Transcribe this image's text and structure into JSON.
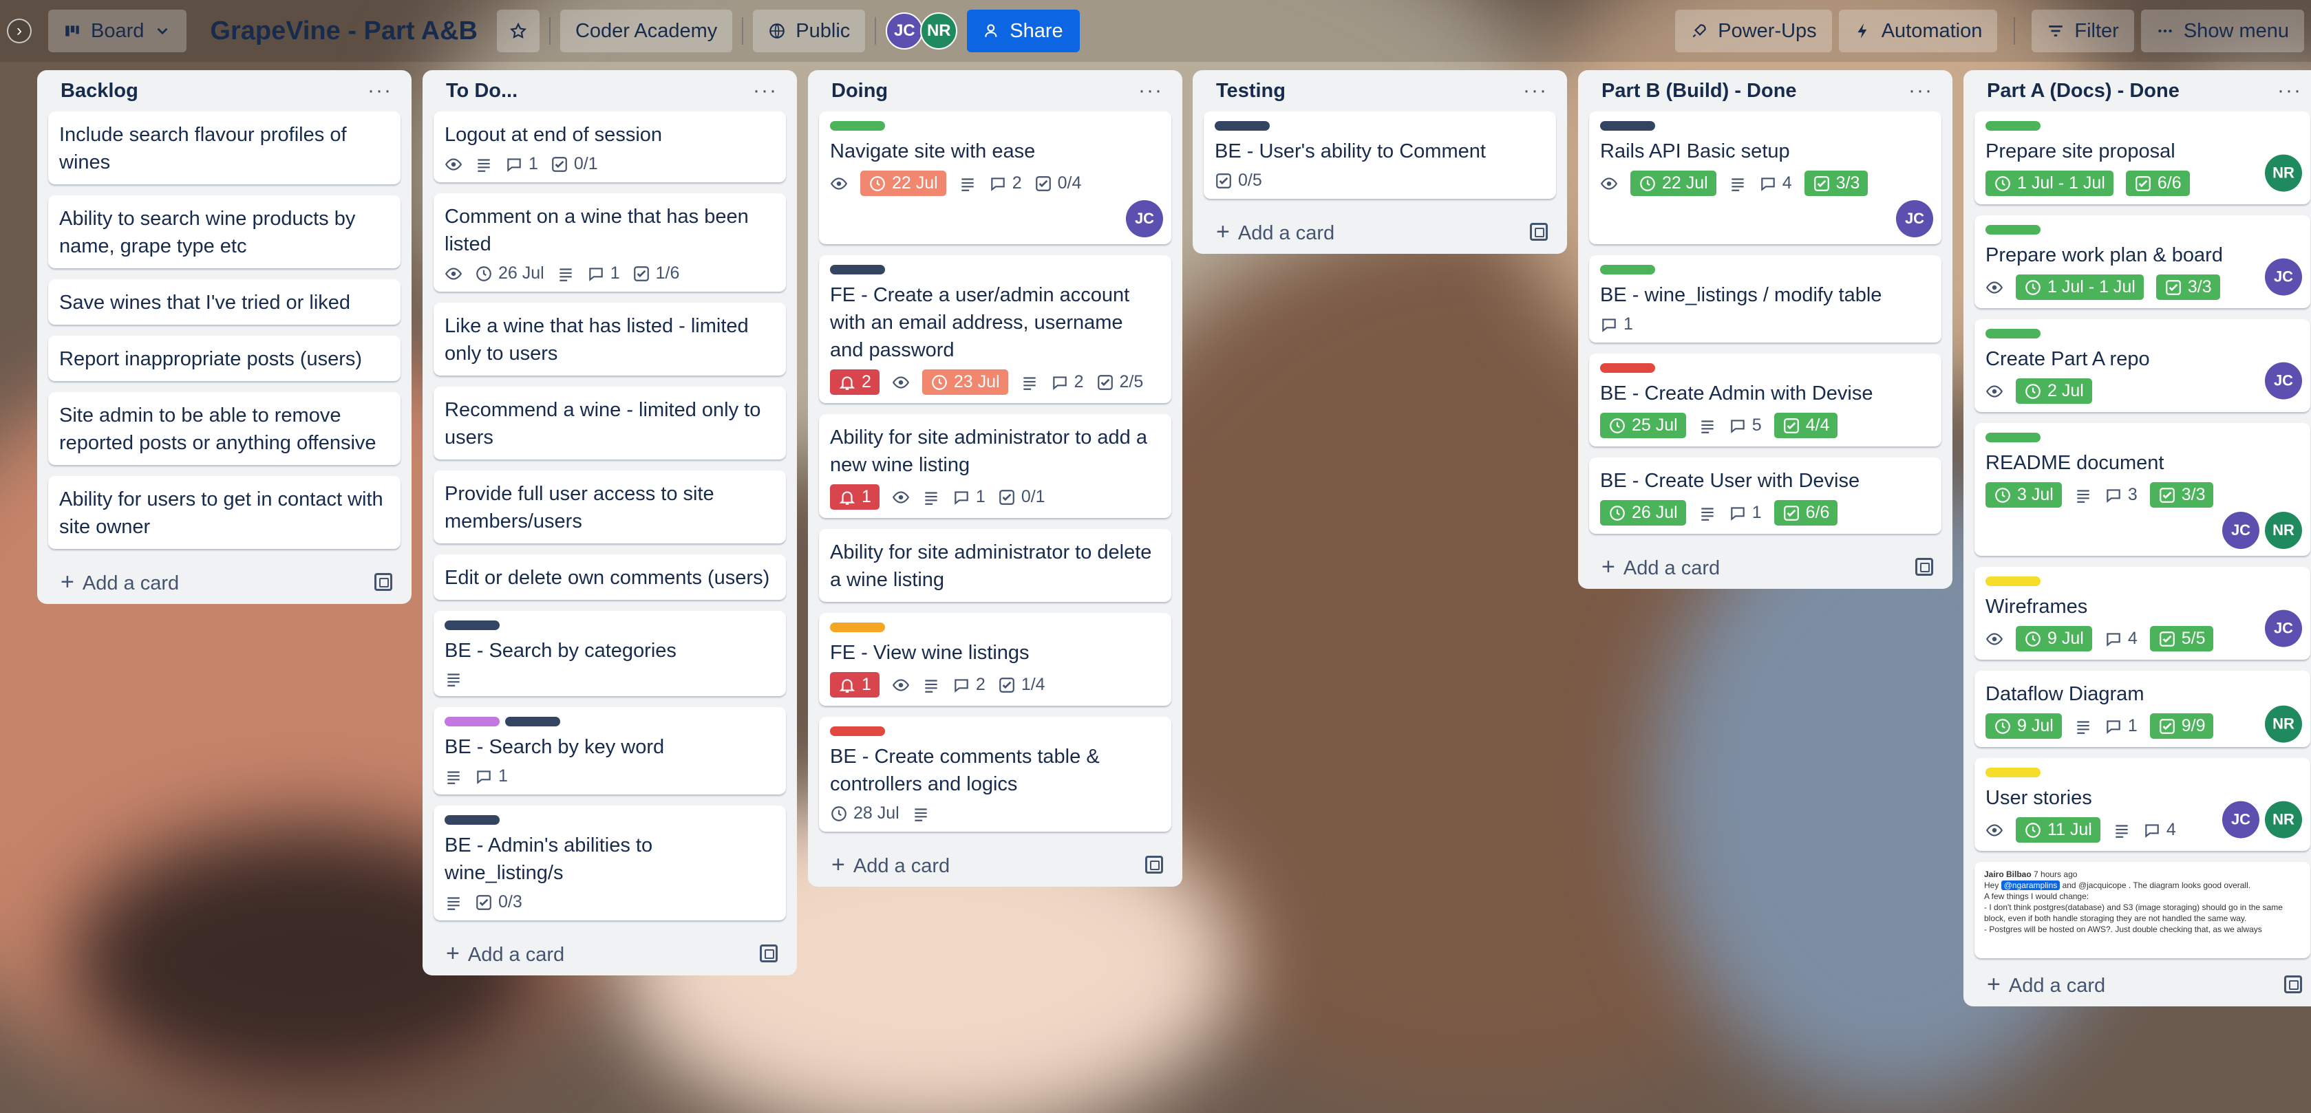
{
  "header": {
    "view_label": "Board",
    "board_title": "GrapeVine - Part A&B",
    "workspace": "Coder Academy",
    "visibility": "Public",
    "members": [
      "JC",
      "NR"
    ],
    "share_label": "Share",
    "power_ups": "Power-Ups",
    "automation": "Automation",
    "filter": "Filter",
    "show_menu": "Show menu"
  },
  "colors": {
    "green": "#4bb35a",
    "navy": "#344563",
    "purple": "#c377e0",
    "orange": "#f5a623",
    "red": "#e2483d",
    "yellow": "#f5dd29",
    "accent": "#0c66e4"
  },
  "add_card_label": "Add a card",
  "lists": [
    {
      "title": "Backlog",
      "cards": [
        {
          "title": "Include search flavour profiles of wines"
        },
        {
          "title": "Ability to search wine products by name, grape type etc"
        },
        {
          "title": "Save wines that I've tried or liked"
        },
        {
          "title": "Report inappropriate posts (users)"
        },
        {
          "title": "Site admin to be able to remove reported posts or anything offensive"
        },
        {
          "title": "Ability for users to get in contact with site owner"
        }
      ]
    },
    {
      "title": "To Do...",
      "cards": [
        {
          "title": "Logout at end of session",
          "comments": "1",
          "checklist": "0/1"
        },
        {
          "title": "Comment on a wine that has been listed",
          "due": "26 Jul",
          "comments": "1",
          "checklist": "1/6"
        },
        {
          "title": "Like a wine that has listed - limited only to users"
        },
        {
          "title": "Recommend a wine - limited only to users"
        },
        {
          "title": "Provide full user access to site members/users"
        },
        {
          "title": "Edit or delete own comments (users)"
        },
        {
          "title": "BE - Search by categories"
        },
        {
          "title": "BE - Search by key word",
          "comments": "1"
        },
        {
          "title": "BE - Admin's abilities to wine_listing/s",
          "checklist": "0/3"
        }
      ]
    },
    {
      "title": "Doing",
      "cards": [
        {
          "title": "Navigate site with ease",
          "due": "22 Jul",
          "comments": "2",
          "checklist": "0/4",
          "member": "JC"
        },
        {
          "title": "FE - Create a user/admin account with an email address, username and password",
          "alerts": "2",
          "due": "23 Jul",
          "comments": "2",
          "checklist": "2/5"
        },
        {
          "title": "Ability for site administrator to add a new wine listing",
          "alerts": "1",
          "comments": "1",
          "checklist": "0/1"
        },
        {
          "title": "Ability for site administrator to delete a wine listing"
        },
        {
          "title": "FE - View wine listings",
          "alerts": "1",
          "comments": "2",
          "checklist": "1/4"
        },
        {
          "title": "BE - Create comments table & controllers and logics",
          "due": "28 Jul"
        }
      ]
    },
    {
      "title": "Testing",
      "cards": [
        {
          "title": "BE - User's ability to Comment",
          "checklist": "0/5"
        }
      ]
    },
    {
      "title": "Part B (Build) - Done",
      "cards": [
        {
          "title": "Rails API Basic setup",
          "due": "22 Jul",
          "comments": "4",
          "checklist": "3/3",
          "member": "JC"
        },
        {
          "title": "BE - wine_listings / modify table",
          "comments": "1"
        },
        {
          "title": "BE - Create Admin with Devise",
          "due": "25 Jul",
          "comments": "5",
          "checklist": "4/4"
        },
        {
          "title": "BE - Create User with Devise",
          "due": "26 Jul",
          "comments": "1",
          "checklist": "6/6"
        }
      ]
    },
    {
      "title": "Part A (Docs) - Done",
      "cards": [
        {
          "title": "Prepare site proposal",
          "due": "1 Jul - 1 Jul",
          "checklist": "6/6",
          "member": "NR"
        },
        {
          "title": "Prepare work plan & board",
          "due": "1 Jul - 1 Jul",
          "checklist": "3/3",
          "member": "JC"
        },
        {
          "title": "Create Part A repo",
          "due": "2 Jul",
          "member": "JC"
        },
        {
          "title": "README document",
          "due": "3 Jul",
          "comments": "3",
          "checklist": "3/3",
          "members": [
            "JC",
            "NR"
          ]
        },
        {
          "title": "Wireframes",
          "due": "9 Jul",
          "comments": "4",
          "checklist": "5/5",
          "member": "JC"
        },
        {
          "title": "Dataflow Diagram",
          "due": "9 Jul",
          "comments": "1",
          "checklist": "9/9",
          "member": "NR"
        },
        {
          "title": "User stories",
          "due": "11 Jul",
          "comments": "4",
          "members": [
            "JC",
            "NR"
          ]
        }
      ],
      "attachment_preview": {
        "author": "Jairo Bilbao",
        "time": "7 hours ago",
        "mention1": "@ngaramplins",
        "mention2": "@jacquicope",
        "line1": "The diagram looks good overall.",
        "line2": "A few things I would change:",
        "line3": "- I don't think postgres(database) and S3 (image storaging) should go in the same block, even if both handle storaging they are not handled the same way.",
        "line4": "- Postgres will be hosted on AWS?. Just double checking that, as we always"
      }
    }
  ]
}
